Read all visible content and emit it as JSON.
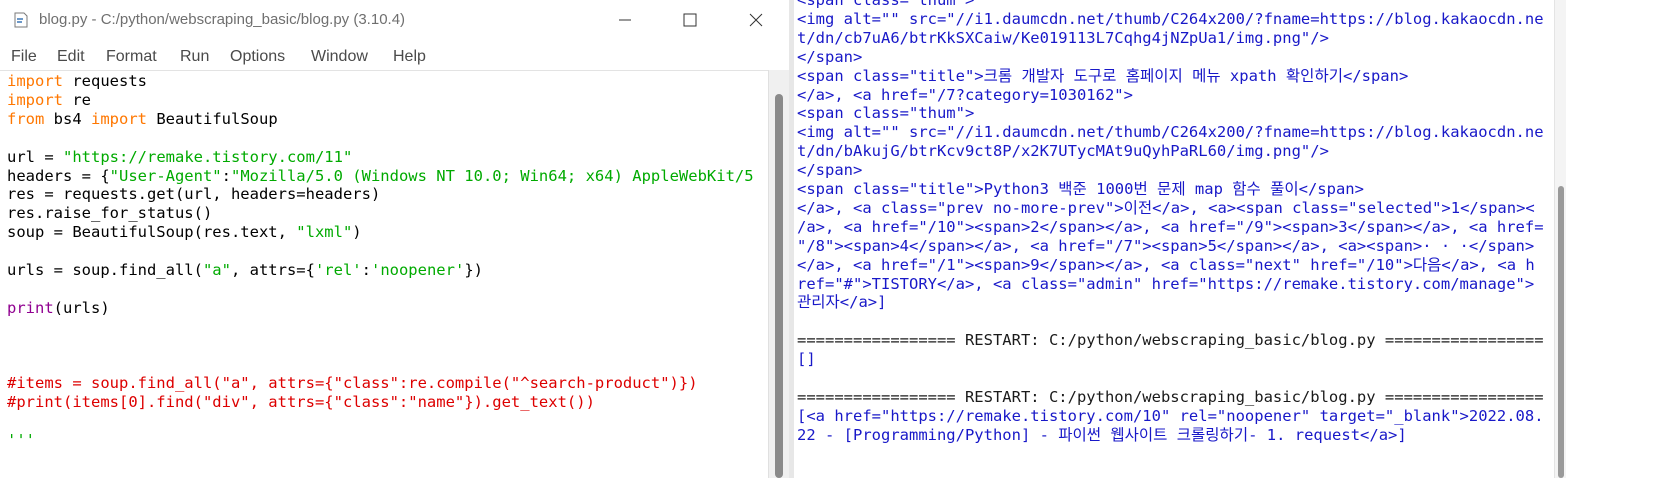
{
  "editor": {
    "title": "blog.py - C:/python/webscraping_basic/blog.py (3.10.4)",
    "menu": [
      "File",
      "Edit",
      "Format",
      "Run",
      "Options",
      "Window",
      "Help"
    ],
    "code": [
      [
        {
          "t": "import",
          "c": "kw"
        },
        {
          "t": " requests",
          "c": ""
        }
      ],
      [
        {
          "t": "import",
          "c": "kw"
        },
        {
          "t": " re",
          "c": ""
        }
      ],
      [
        {
          "t": "from",
          "c": "kw"
        },
        {
          "t": " bs4 ",
          "c": ""
        },
        {
          "t": "import",
          "c": "kw"
        },
        {
          "t": " BeautifulSoup",
          "c": ""
        }
      ],
      [],
      [
        {
          "t": "url = ",
          "c": ""
        },
        {
          "t": "\"https://remake.tistory.com/11\"",
          "c": "str"
        }
      ],
      [
        {
          "t": "headers = {",
          "c": ""
        },
        {
          "t": "\"User-Agent\"",
          "c": "str"
        },
        {
          "t": ":",
          "c": ""
        },
        {
          "t": "\"Mozilla/5.0 (Windows NT 10.0; Win64; x64) AppleWebKit/5",
          "c": "str"
        }
      ],
      [
        {
          "t": "res = requests.get(url, headers=headers)",
          "c": ""
        }
      ],
      [
        {
          "t": "res.raise_for_status()",
          "c": ""
        }
      ],
      [
        {
          "t": "soup = BeautifulSoup(res.text, ",
          "c": ""
        },
        {
          "t": "\"lxml\"",
          "c": "str"
        },
        {
          "t": ")",
          "c": ""
        }
      ],
      [],
      [
        {
          "t": "urls = soup.find_all(",
          "c": ""
        },
        {
          "t": "\"a\"",
          "c": "str"
        },
        {
          "t": ", attrs={",
          "c": ""
        },
        {
          "t": "'rel'",
          "c": "str"
        },
        {
          "t": ":",
          "c": ""
        },
        {
          "t": "'noopener'",
          "c": "str"
        },
        {
          "t": "})",
          "c": ""
        }
      ],
      [],
      [
        {
          "t": "print",
          "c": "bi"
        },
        {
          "t": "(urls)",
          "c": ""
        }
      ],
      [],
      [],
      [],
      [
        {
          "t": "#items = soup.find_all(\"a\", attrs={\"class\":re.compile(\"^search-product\")})",
          "c": "cm"
        }
      ],
      [
        {
          "t": "#print(items[0].find(\"div\", attrs={\"class\":\"name\"}).get_text())",
          "c": "cm"
        }
      ],
      [],
      [
        {
          "t": "'''",
          "c": "str"
        }
      ]
    ]
  },
  "shell": {
    "lines": [
      {
        "t": "<span class=\"thum\">",
        "c": ""
      },
      {
        "t": "<img alt=\"\" src=\"//i1.daumcdn.net/thumb/C264x200/?fname=https://blog.kakaocdn.ne",
        "c": ""
      },
      {
        "t": "t/dn/cb7uA6/btrKkSXCaiw/Ke019113L7Cqhg4jNZpUa1/img.png\"/>",
        "c": ""
      },
      {
        "t": "</span>",
        "c": ""
      },
      {
        "t": "<span class=\"title\">크롬 개발자 도구로 홈페이지 메뉴 xpath 확인하기</span>",
        "c": ""
      },
      {
        "t": "</a>, <a href=\"/7?category=1030162\">",
        "c": ""
      },
      {
        "t": "<span class=\"thum\">",
        "c": ""
      },
      {
        "t": "<img alt=\"\" src=\"//i1.daumcdn.net/thumb/C264x200/?fname=https://blog.kakaocdn.ne",
        "c": ""
      },
      {
        "t": "t/dn/bAkujG/btrKcv9ct8P/x2K7UTycMAt9uQyhPaRL60/img.png\"/>",
        "c": ""
      },
      {
        "t": "</span>",
        "c": ""
      },
      {
        "t": "<span class=\"title\">Python3 백준 1000번 문제 map 함수 풀이</span>",
        "c": ""
      },
      {
        "t": "</a>, <a class=\"prev no-more-prev\">이전</a>, <a><span class=\"selected\">1</span><",
        "c": ""
      },
      {
        "t": "/a>, <a href=\"/10\"><span>2</span></a>, <a href=\"/9\"><span>3</span></a>, <a href=",
        "c": ""
      },
      {
        "t": "\"/8\"><span>4</span></a>, <a href=\"/7\"><span>5</span></a>, <a><span>· · ·</span>",
        "c": ""
      },
      {
        "t": "</a>, <a href=\"/1\"><span>9</span></a>, <a class=\"next\" href=\"/10\">다음</a>, <a h",
        "c": ""
      },
      {
        "t": "ref=\"#\">TISTORY</a>, <a class=\"admin\" href=\"https://remake.tistory.com/manage\">",
        "c": ""
      },
      {
        "t": "관리자</a>]",
        "c": ""
      },
      {
        "t": "",
        "c": ""
      },
      {
        "t": "================= RESTART: C:/python/webscraping_basic/blog.py =================",
        "c": "restart"
      },
      {
        "t": "[]",
        "c": ""
      },
      {
        "t": "",
        "c": ""
      },
      {
        "t": "================= RESTART: C:/python/webscraping_basic/blog.py =================",
        "c": "restart"
      },
      {
        "t": "[<a href=\"https://remake.tistory.com/10\" rel=\"noopener\" target=\"_blank\">2022.08.",
        "c": ""
      },
      {
        "t": "22 - [Programming/Python] - 파이썬 웹사이트 크롤링하기- 1. request</a>]",
        "c": ""
      }
    ]
  }
}
